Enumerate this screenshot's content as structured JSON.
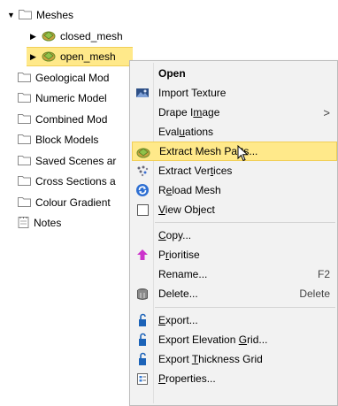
{
  "tree": {
    "meshes_label": "Meshes",
    "closed_mesh_label": "closed_mesh",
    "open_mesh_label": "open_mesh",
    "geological_label": "Geological Mod",
    "numeric_label": "Numeric Model",
    "combined_label": "Combined Mod",
    "block_label": "Block Models",
    "saved_label": "Saved Scenes ar",
    "cross_label": "Cross Sections a",
    "colour_label": "Colour Gradient",
    "notes_label": "Notes"
  },
  "menu": {
    "open": "Open",
    "import_texture": "Import Texture",
    "drape_image_pre": "Drape I",
    "drape_image_ul": "m",
    "drape_image_post": "age",
    "drape_arrow": ">",
    "evaluations_pre": "Eval",
    "evaluations_ul": "u",
    "evaluations_post": "ations",
    "extract_mesh_parts": "Extract Mesh Parts...",
    "extract_vertices_pre": "Extract Ver",
    "extract_vertices_ul": "t",
    "extract_vertices_post": "ices",
    "reload_mesh_pre": "R",
    "reload_mesh_ul": "e",
    "reload_mesh_post": "load Mesh",
    "view_object_ul": "V",
    "view_object_post": "iew Object",
    "copy_ul": "C",
    "copy_post": "opy...",
    "prioritise_pre": "P",
    "prioritise_ul": "r",
    "prioritise_post": "ioritise",
    "rename": "Rename...",
    "rename_shortcut": "F2",
    "delete": "Delete...",
    "delete_shortcut": "Delete",
    "export_ul": "E",
    "export_post": "xport...",
    "export_elev_pre": "Export Elevation ",
    "export_elev_ul": "G",
    "export_elev_post": "rid...",
    "export_thick_pre": "Export ",
    "export_thick_ul": "T",
    "export_thick_post": "hickness Grid",
    "properties_ul": "P",
    "properties_post": "roperties..."
  },
  "colors": {
    "highlight": "#ffe98a",
    "highlight_border": "#f1cf57",
    "menu_bg": "#f2f2f2",
    "folder": "#e8c56a"
  },
  "icons": [
    "folder-icon",
    "mesh-icon",
    "import-texture-icon",
    "extract-mesh-parts-icon",
    "extract-vertices-icon",
    "reload-mesh-icon",
    "checkbox-icon",
    "prioritise-arrow-icon",
    "delete-bin-icon",
    "export-icon",
    "properties-icon",
    "notes-icon",
    "mouse-cursor-icon"
  ]
}
